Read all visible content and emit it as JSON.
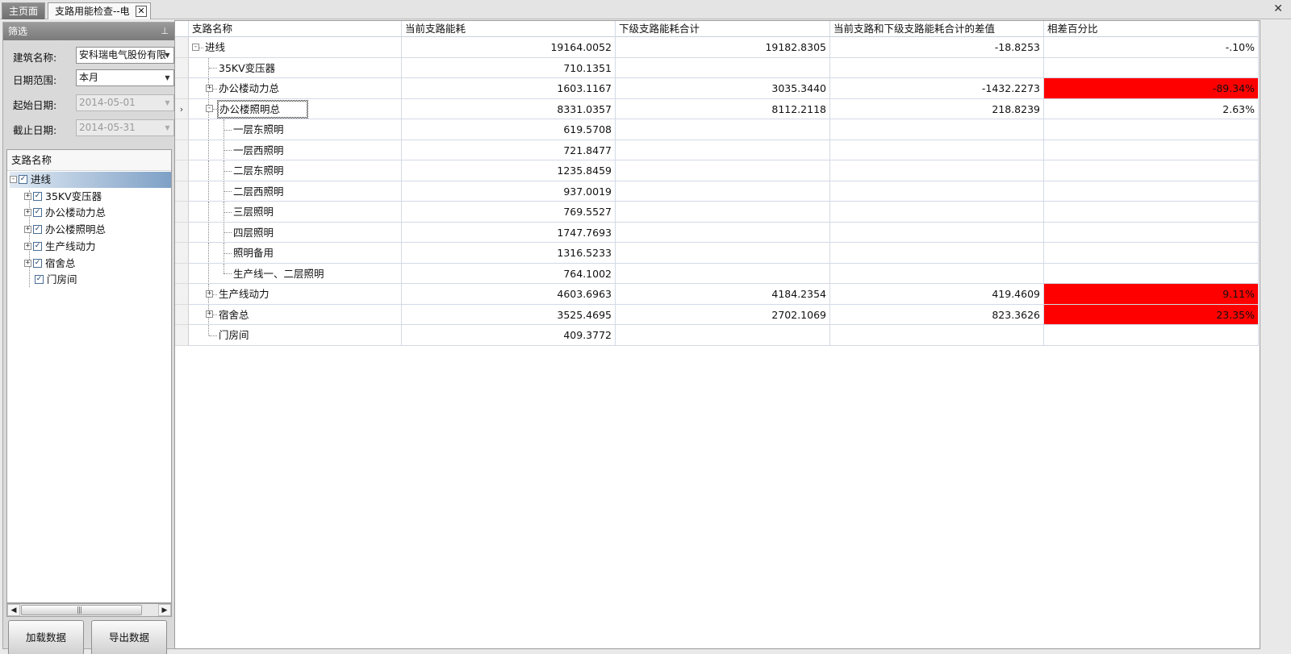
{
  "tabs": {
    "home": "主页面",
    "check": "支路用能检查--电",
    "close_glyph": "✕",
    "window_close": "✕"
  },
  "filter": {
    "title": "筛选",
    "pin": "ᵖ",
    "building_label": "建筑名称:",
    "building_value": "安科瑞电气股份有限",
    "date_range_label": "日期范围:",
    "date_range_value": "本月",
    "start_label": "起始日期:",
    "start_value": "2014-05-01",
    "end_label": "截止日期:",
    "end_value": "2014-05-31"
  },
  "tree": {
    "header": "支路名称",
    "nodes": [
      {
        "label": "进线",
        "checked": true,
        "expanded": true
      },
      {
        "label": "35KV变压器",
        "checked": true,
        "expanded": false
      },
      {
        "label": "办公楼动力总",
        "checked": true,
        "expanded": false
      },
      {
        "label": "办公楼照明总",
        "checked": true,
        "expanded": false
      },
      {
        "label": "生产线动力",
        "checked": true,
        "expanded": false
      },
      {
        "label": "宿舍总",
        "checked": true,
        "expanded": false
      },
      {
        "label": "门房间",
        "checked": true,
        "expanded": false
      }
    ]
  },
  "buttons": {
    "load": "加载数据",
    "export": "导出数据"
  },
  "grid": {
    "columns": [
      "支路名称",
      "当前支路能耗",
      "下级支路能耗合计",
      "当前支路和下级支路能耗合计的差值",
      "相差百分比"
    ],
    "rows": [
      {
        "name": "进线",
        "current": "19164.0052",
        "children_sum": "19182.8305",
        "diff": "-18.8253",
        "pct": "-.10%",
        "alert": false
      },
      {
        "name": "35KV变压器",
        "current": "710.1351",
        "children_sum": "",
        "diff": "",
        "pct": "",
        "alert": false
      },
      {
        "name": "办公楼动力总",
        "current": "1603.1167",
        "children_sum": "3035.3440",
        "diff": "-1432.2273",
        "pct": "-89.34%",
        "alert": true
      },
      {
        "name": "办公楼照明总",
        "current": "8331.0357",
        "children_sum": "8112.2118",
        "diff": "218.8239",
        "pct": "2.63%",
        "alert": false
      },
      {
        "name": "一层东照明",
        "current": "619.5708",
        "children_sum": "",
        "diff": "",
        "pct": "",
        "alert": false
      },
      {
        "name": "一层西照明",
        "current": "721.8477",
        "children_sum": "",
        "diff": "",
        "pct": "",
        "alert": false
      },
      {
        "name": "二层东照明",
        "current": "1235.8459",
        "children_sum": "",
        "diff": "",
        "pct": "",
        "alert": false
      },
      {
        "name": "二层西照明",
        "current": "937.0019",
        "children_sum": "",
        "diff": "",
        "pct": "",
        "alert": false
      },
      {
        "name": "三层照明",
        "current": "769.5527",
        "children_sum": "",
        "diff": "",
        "pct": "",
        "alert": false
      },
      {
        "name": "四层照明",
        "current": "1747.7693",
        "children_sum": "",
        "diff": "",
        "pct": "",
        "alert": false
      },
      {
        "name": "照明备用",
        "current": "1316.5233",
        "children_sum": "",
        "diff": "",
        "pct": "",
        "alert": false
      },
      {
        "name": "生产线一、二层照明",
        "current": "764.1002",
        "children_sum": "",
        "diff": "",
        "pct": "",
        "alert": false
      },
      {
        "name": "生产线动力",
        "current": "4603.6963",
        "children_sum": "4184.2354",
        "diff": "419.4609",
        "pct": "9.11%",
        "alert": true
      },
      {
        "name": "宿舍总",
        "current": "3525.4695",
        "children_sum": "2702.1069",
        "diff": "823.3626",
        "pct": "23.35%",
        "alert": true
      },
      {
        "name": "门房间",
        "current": "409.3772",
        "children_sum": "",
        "diff": "",
        "pct": "",
        "alert": false
      }
    ],
    "current_row_marker": "›",
    "alert_color": "#ff0000"
  }
}
